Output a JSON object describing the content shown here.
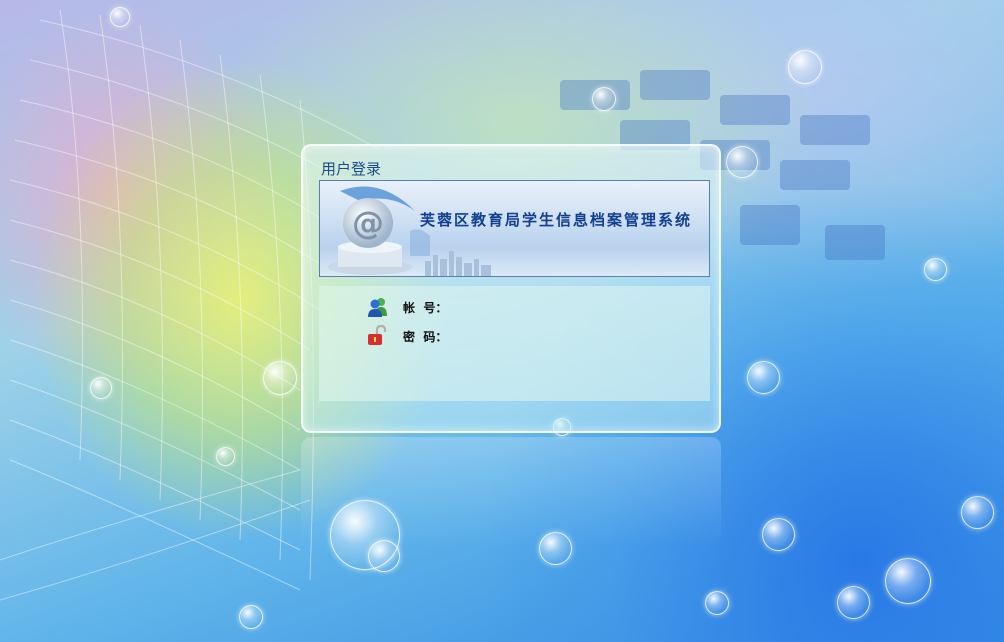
{
  "panel": {
    "title": "用户登录"
  },
  "banner": {
    "system_name": "芙蓉区教育局学生信息档案管理系统",
    "logo_icon": "at-sign-icon"
  },
  "form": {
    "account_label": "帐  号：",
    "account_icon": "users-icon",
    "password_label": "密  码：",
    "password_icon": "padlock-icon"
  },
  "colors": {
    "title_text": "#1a4c8a",
    "banner_text": "#123f8e",
    "panel_border": "#ffffff"
  }
}
